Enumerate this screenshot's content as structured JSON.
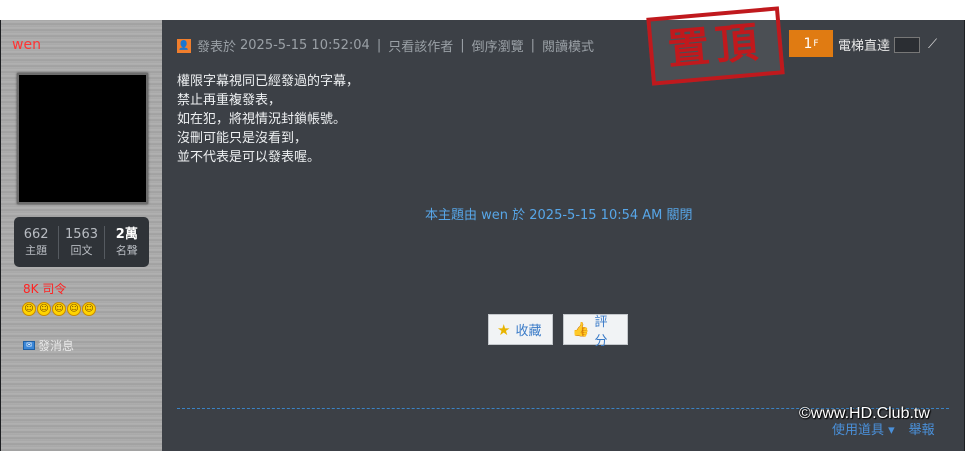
{
  "sidebar": {
    "username": "wen",
    "stats": [
      {
        "value": "662",
        "label": "主題"
      },
      {
        "value": "1563",
        "label": "回文"
      },
      {
        "value": "2萬",
        "label": "名聲"
      }
    ],
    "rank": "8K 司令",
    "smiley_count": 5,
    "pm_label": "發消息"
  },
  "post_meta": {
    "posted_prefix": "發表於",
    "posted_time": "2025-5-15 10:52:04",
    "author_only": "只看該作者",
    "reverse": "倒序瀏覽",
    "read_mode": "閱讀模式"
  },
  "stamp_text": "置頂",
  "floor": {
    "number": "1",
    "suffix": "F"
  },
  "elevator_label": "電梯直達",
  "elevator_go": "⟋",
  "post_lines": [
    "權限字幕視同已經發過的字幕，",
    "禁止再重複發表，",
    "如在犯，將視情況封鎖帳號。",
    "沒刪可能只是沒看到，",
    "並不代表是可以發表喔。"
  ],
  "closed_notice": "本主題由 wen 於 2025-5-15 10:54 AM 關閉",
  "buttons": {
    "favorite": "收藏",
    "rate": "評分"
  },
  "bottom_links": {
    "tools": "使用道具 ▾",
    "report": "舉報"
  },
  "watermark": "©www.HD.Club.tw"
}
